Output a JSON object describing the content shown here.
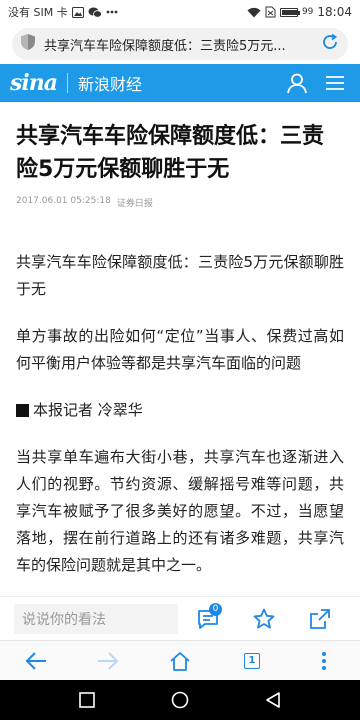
{
  "status_bar": {
    "carrier": "没有 SIM 卡",
    "battery_level": "99",
    "time": "18:04",
    "battery_fill": 0.99
  },
  "address_bar": {
    "title": "共享汽车车险保障额度低：三责险5万元..."
  },
  "site_header": {
    "logo_text": "sina",
    "channel": "新浪财经"
  },
  "article": {
    "headline": "共享汽车车险保障额度低：三责险5万元保额聊胜于无",
    "date": "2017.06.01 05:25:18",
    "source": "证券日报",
    "paragraphs": [
      "共享汽车车险保障额度低：三责险5万元保额聊胜于无",
      "单方事故的出险如何“定位”当事人、保费过高如何平衡用户体验等都是共享汽车面临的问题"
    ],
    "reporter": "本报记者 冷翠华",
    "body": "当共享单车遍布大街小巷，共享汽车也逐渐进入人们的视野。节约资源、缓解摇号难等问题，共享汽车被赋予了很多美好的愿望。不过，当愿望落地，摆在前行道路上的还有诸多难题，共享汽车的保险问题就是其中之一。"
  },
  "comment_bar": {
    "placeholder": "说说你的看法",
    "comment_count": "0"
  },
  "browser_nav": {
    "tab_count": "1"
  },
  "colors": {
    "brand_blue": "#1e9ae6",
    "accent_blue": "#1e88e5"
  }
}
